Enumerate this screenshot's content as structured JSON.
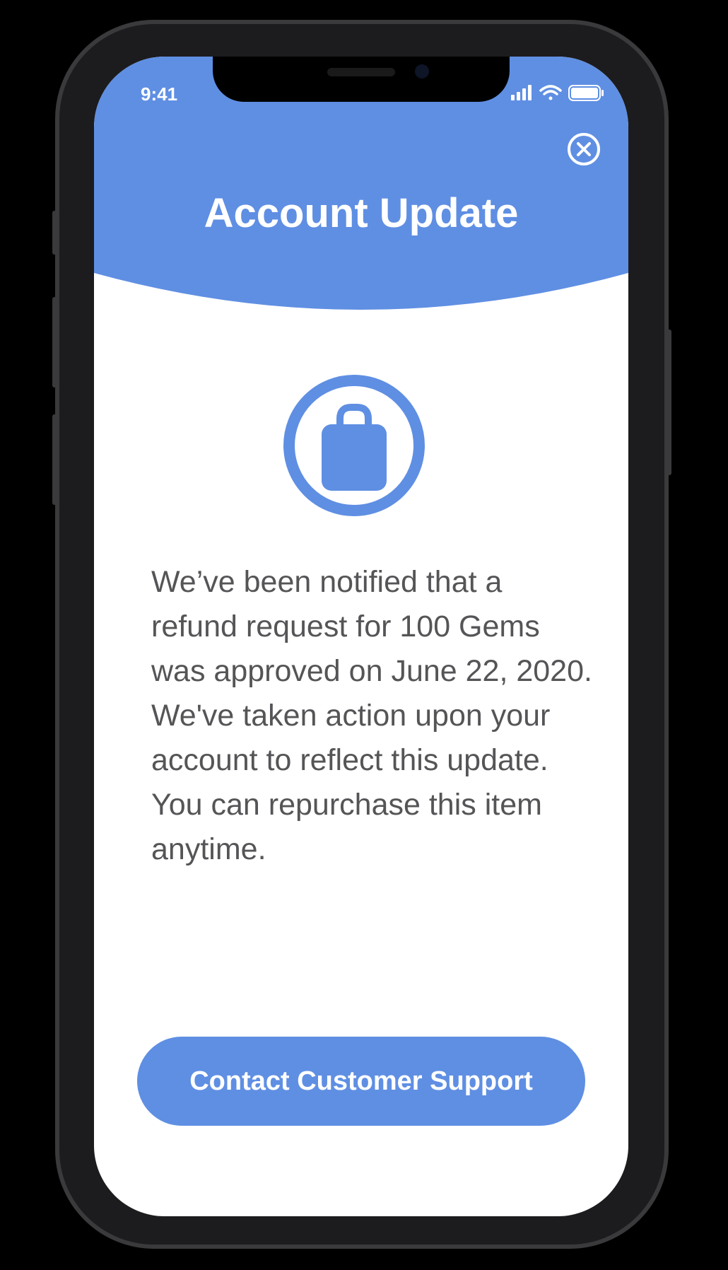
{
  "status_bar": {
    "time": "9:41",
    "icons": [
      "cellular-signal-icon",
      "wifi-icon",
      "battery-icon"
    ]
  },
  "header": {
    "title": "Account Update",
    "close_icon": "close-icon"
  },
  "badge": {
    "icon": "shopping-bag-icon"
  },
  "message": {
    "body": "We’ve been notified that a refund request for 100 Gems was approved on June 22, 2020. We've taken action upon your account to reflect this update. You can repurchase this item anytime."
  },
  "actions": {
    "contact_label": "Contact Customer Support"
  },
  "colors": {
    "accent": "#5f8fe3",
    "background": "#000000",
    "text": "#555558"
  }
}
